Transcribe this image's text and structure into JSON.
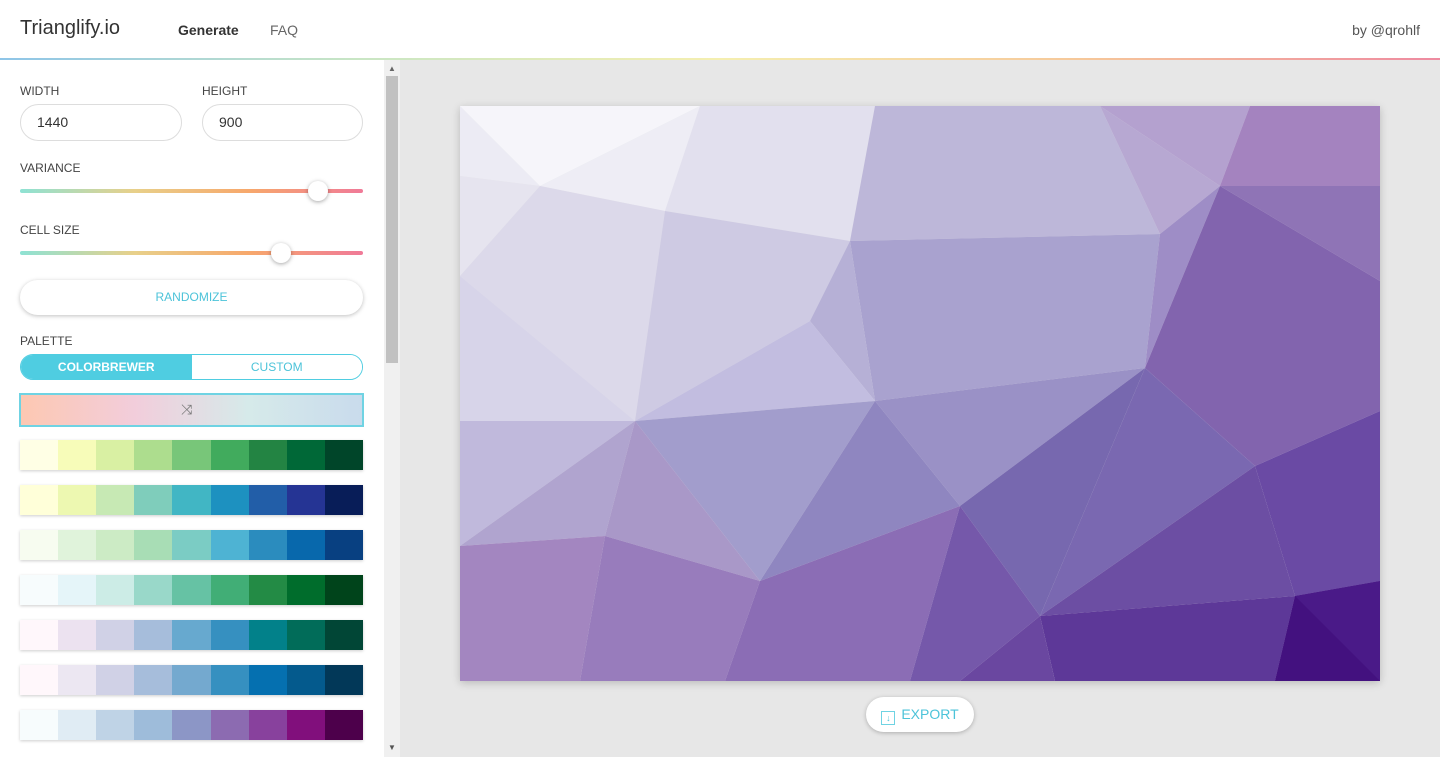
{
  "app": {
    "title": "Trianglify.io",
    "byline": "by @qrohlf"
  },
  "nav": {
    "generate": "Generate",
    "faq": "FAQ"
  },
  "controls": {
    "width_label": "WIDTH",
    "width_value": "1440",
    "height_label": "HEIGHT",
    "height_value": "900",
    "variance_label": "VARIANCE",
    "variance_level": 0.87,
    "cell_size_label": "CELL SIZE",
    "cell_size_level": 0.76,
    "randomize_label": "RANDOMIZE",
    "palette_label": "PALETTE",
    "palette_tabs": {
      "colorbrewer": "COLORBREWER",
      "custom": "CUSTOM"
    },
    "shuffle_icon": "shuffle-icon"
  },
  "palettes": [
    [
      "#ffffe5",
      "#f7fcb9",
      "#d9f0a3",
      "#addd8e",
      "#78c679",
      "#41ab5d",
      "#238443",
      "#006837",
      "#004529"
    ],
    [
      "#ffffd9",
      "#edf8b1",
      "#c7e9b4",
      "#7fcdbb",
      "#41b6c4",
      "#1d91c0",
      "#225ea8",
      "#253494",
      "#081d58"
    ],
    [
      "#f7fcf0",
      "#e0f3db",
      "#ccebc5",
      "#a8ddb5",
      "#7bccc4",
      "#4eb3d3",
      "#2b8cbe",
      "#0868ac",
      "#084081"
    ],
    [
      "#f7fcfd",
      "#e5f5f9",
      "#ccece6",
      "#99d8c9",
      "#66c2a4",
      "#41ae76",
      "#238b45",
      "#006d2c",
      "#00441b"
    ],
    [
      "#fff7fb",
      "#ece2f0",
      "#d0d1e6",
      "#a6bddb",
      "#67a9cf",
      "#3690c0",
      "#02818a",
      "#016c59",
      "#014636"
    ],
    [
      "#fff7fb",
      "#ece7f2",
      "#d0d1e6",
      "#a6bddb",
      "#74a9cf",
      "#3690c0",
      "#0570b0",
      "#045a8d",
      "#023858"
    ],
    [
      "#f7fcfd",
      "#e0ecf4",
      "#bfd3e6",
      "#9ebcda",
      "#8c96c6",
      "#8c6bb1",
      "#88419d",
      "#810f7c",
      "#4d004b"
    ]
  ],
  "export": {
    "label": "EXPORT",
    "icon": "download-icon"
  }
}
